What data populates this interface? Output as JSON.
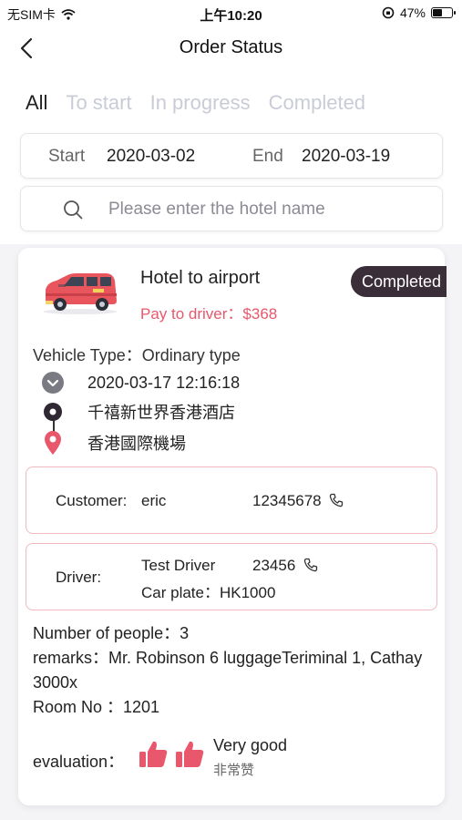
{
  "status_bar": {
    "carrier": "无SIM卡",
    "time": "上午10:20",
    "battery": "47%",
    "battery_level": 0.47
  },
  "nav": {
    "title": "Order Status",
    "back_icon": "chevron-left-icon"
  },
  "tabs": [
    {
      "label": "All",
      "active": true
    },
    {
      "label": "To start",
      "active": false
    },
    {
      "label": "In progress",
      "active": false
    },
    {
      "label": "Completed",
      "active": false
    }
  ],
  "date_filter": {
    "start_label": "Start",
    "start_value": "2020-03-02",
    "end_label": "End",
    "end_value": "2020-03-19"
  },
  "search": {
    "placeholder": "Please enter the hotel name",
    "value": ""
  },
  "order": {
    "route_title": "Hotel to airport",
    "pay_label": "Pay to driver：$368",
    "status": "Completed",
    "vehicle_type": "Vehicle Type：Ordinary type",
    "datetime": "2020-03-17 12:16:18",
    "pickup": "千禧新世界香港酒店",
    "dropoff": "香港國際機場",
    "customer": {
      "label": "Customer:",
      "name": "eric",
      "phone": "12345678"
    },
    "driver": {
      "label": "Driver:",
      "name": "Test Driver",
      "phone": "23456",
      "car_plate": "Car plate：HK1000"
    },
    "number_of_people": "Number of people：3",
    "remarks": "remarks：Mr. Robinson 6 luggageTeriminal 1, Cathay 3000x",
    "room_no": "Room No ：1201",
    "evaluation": {
      "label": "evaluation：",
      "rating_en": "Very good",
      "rating_cn": "非常赞",
      "thumbs_up_count": 2
    }
  },
  "colors": {
    "accent_pink": "#e8576b",
    "badge_dark": "#3a2e38",
    "tab_inactive": "#c9ccd6",
    "info_border": "#f0b9c1"
  }
}
